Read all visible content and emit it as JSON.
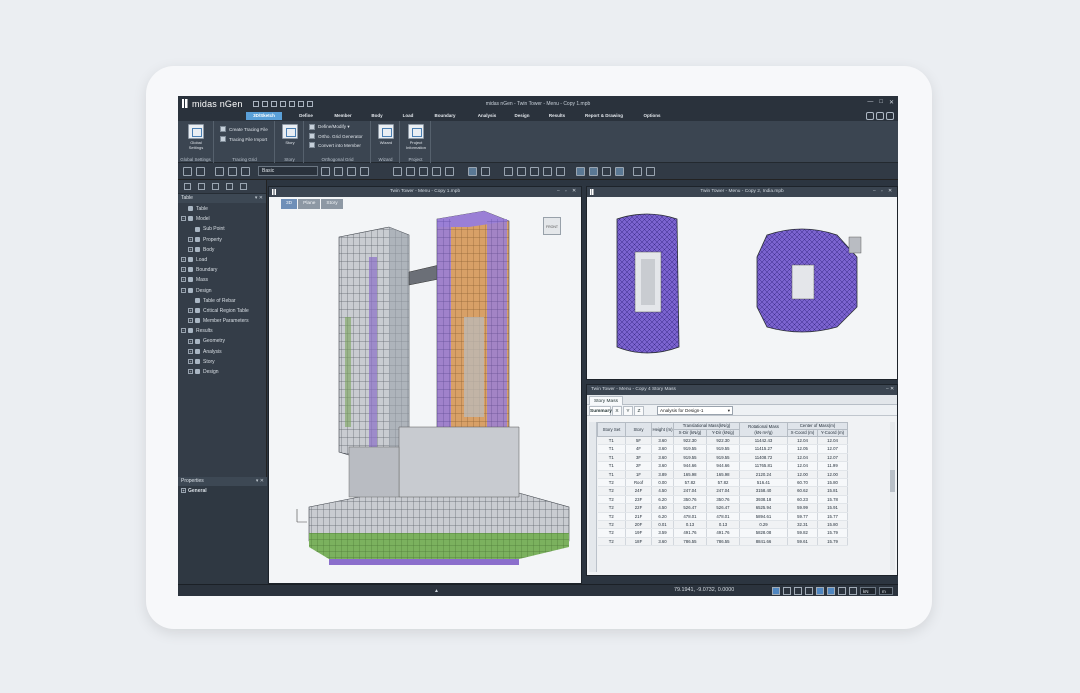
{
  "app": {
    "logo": "midas nGen",
    "window_title": "midas nGen - Twin Tower - Menu - Copy 1.mpb"
  },
  "ribbon": {
    "tabs": [
      "3D/Sketch",
      "Define",
      "Member",
      "Body",
      "Load",
      "Boundary",
      "Analysis",
      "Design",
      "Results",
      "Report & Drawing",
      "Options"
    ],
    "active_tab": "3D/Sketch",
    "groups": {
      "global_settings": {
        "label": "Global Settings",
        "button": "Global Settings"
      },
      "tracing_grid": {
        "label": "Tracing Grid",
        "create": "Create Tracing File",
        "import": "Tracing File Import"
      },
      "story": {
        "label": "Story",
        "button": "Story"
      },
      "orthogonal_grid": {
        "label": "Orthogonal Grid",
        "define": "Define/Modify ▾",
        "generator": "Ortho. Grid Generator",
        "convert": "Convert into Member"
      },
      "wizard": {
        "label": "Wizard",
        "button": "Wizard"
      },
      "project": {
        "label": "Project",
        "button": "Project Information"
      }
    }
  },
  "toolbar": {
    "mode_select": "Basic"
  },
  "left_panel": {
    "table_title": "Table",
    "tree": [
      {
        "label": "Table",
        "level": 0,
        "expander": ""
      },
      {
        "label": "Model",
        "level": 0,
        "expander": "−"
      },
      {
        "label": "Sub Point",
        "level": 1,
        "expander": ""
      },
      {
        "label": "Property",
        "level": 1,
        "expander": "+"
      },
      {
        "label": "Body",
        "level": 1,
        "expander": "+"
      },
      {
        "label": "Load",
        "level": 0,
        "expander": "+"
      },
      {
        "label": "Boundary",
        "level": 0,
        "expander": "+"
      },
      {
        "label": "Mass",
        "level": 0,
        "expander": "+"
      },
      {
        "label": "Design",
        "level": 0,
        "expander": "−"
      },
      {
        "label": "Table of Rebar",
        "level": 1,
        "expander": ""
      },
      {
        "label": "Critical Region Table",
        "level": 1,
        "expander": "+"
      },
      {
        "label": "Member Parameters",
        "level": 1,
        "expander": "+"
      },
      {
        "label": "Results",
        "level": 0,
        "expander": "−"
      },
      {
        "label": "Geometry",
        "level": 1,
        "expander": "+"
      },
      {
        "label": "Analysis",
        "level": 1,
        "expander": "+"
      },
      {
        "label": "Story",
        "level": 1,
        "expander": "+"
      },
      {
        "label": "Design",
        "level": 1,
        "expander": "+"
      }
    ],
    "properties_title": "Properties",
    "properties_item": "General"
  },
  "viewport_main": {
    "title": "Twin Tower - Menu - Copy 1.mpb",
    "view_tabs": [
      "3D",
      "Plane",
      "Story"
    ],
    "active_view": "3D",
    "cube_label": "FRONT"
  },
  "viewport_plan": {
    "title": "Twin Tower - Menu - Copy 2, India.mpb"
  },
  "table_panel": {
    "title": "Twin Tower - Menu - Copy 4 Story Mass",
    "sub_tab": "Story Mass",
    "tabs": [
      "Summary",
      "X",
      "Y",
      "Z"
    ],
    "active_tab": "Summary",
    "dropdown": "Analysis for Design-1",
    "headers": {
      "story_set": "Story Set",
      "story": "Story",
      "height": "Height (m)",
      "trans_mass": "Translational Mass(kN/g)",
      "x_dir": "X-Dir (kN/g)",
      "y_dir": "Y-Dir (kN/g)",
      "rot_mass": "Rotational Mass (kN·m²/g)",
      "center": "Center of Mass(m)",
      "x_coord": "X-Coord (m)",
      "y_coord": "Y-Coord (m)"
    },
    "rows": [
      [
        "T1",
        "5F",
        "3.60",
        "922.30",
        "922.30",
        "11442.43",
        "12.04",
        "12.04"
      ],
      [
        "T1",
        "4F",
        "3.60",
        "919.55",
        "919.55",
        "11415.27",
        "12.05",
        "12.07"
      ],
      [
        "T1",
        "3F",
        "3.60",
        "919.55",
        "919.55",
        "11408.72",
        "12.04",
        "12.07"
      ],
      [
        "T1",
        "2F",
        "3.60",
        "944.66",
        "944.66",
        "11765.81",
        "12.04",
        "11.99"
      ],
      [
        "T1",
        "1F",
        "3.89",
        "165.98",
        "165.98",
        "2120.24",
        "12.00",
        "12.00"
      ],
      [
        "T2",
        "Roof",
        "0.00",
        "57.82",
        "57.82",
        "516.41",
        "60.70",
        "15.80"
      ],
      [
        "T2",
        "24F",
        "4.50",
        "247.04",
        "247.04",
        "3158.40",
        "60.62",
        "15.81"
      ],
      [
        "T2",
        "23F",
        "6.20",
        "350.76",
        "350.76",
        "3938.18",
        "60.23",
        "15.78"
      ],
      [
        "T2",
        "22F",
        "4.50",
        "526.47",
        "526.47",
        "6525.94",
        "59.99",
        "15.91"
      ],
      [
        "T2",
        "21F",
        "6.20",
        "478.01",
        "478.01",
        "5894.61",
        "59.77",
        "15.77"
      ],
      [
        "T2",
        "20F",
        "0.01",
        "0.13",
        "0.13",
        "0.29",
        "32.31",
        "15.80"
      ],
      [
        "T2",
        "19F",
        "3.59",
        "491.76",
        "491.76",
        "5828.08",
        "59.82",
        "15.79"
      ],
      [
        "T2",
        "18F",
        "3.60",
        "786.55",
        "786.55",
        "8841.66",
        "59.61",
        "15.79"
      ]
    ]
  },
  "status_bar": {
    "coords": "79.1941, -9.0732, 0.0000",
    "unit": "kN",
    "unit2": "m"
  }
}
